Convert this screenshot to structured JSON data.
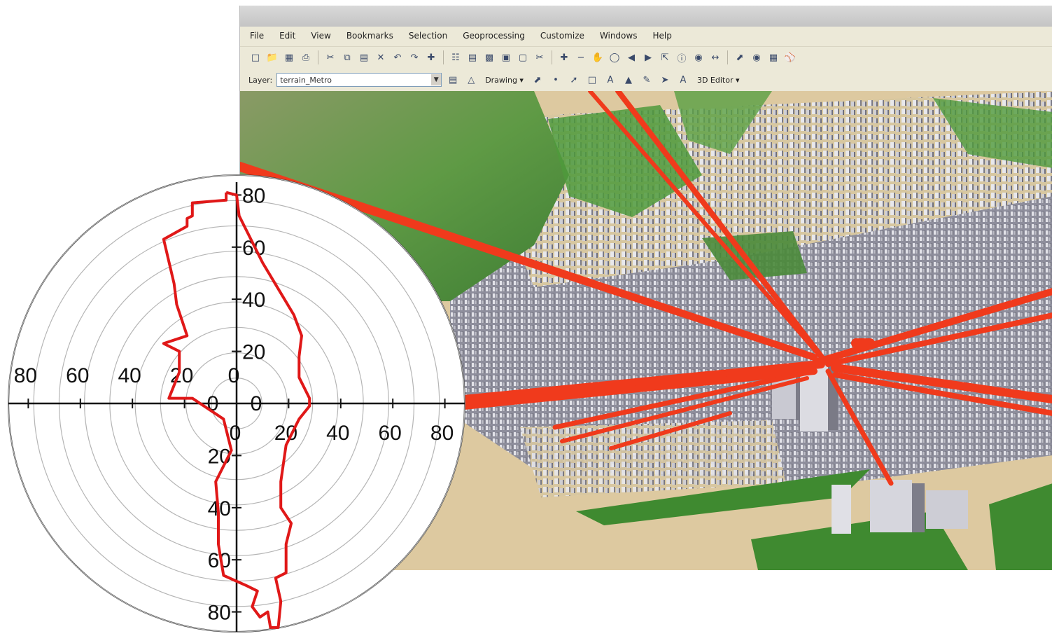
{
  "menu": {
    "items": [
      "File",
      "Edit",
      "View",
      "Bookmarks",
      "Selection",
      "Geoprocessing",
      "Customize",
      "Windows",
      "Help"
    ]
  },
  "toolbar1": {
    "icons": [
      "new-document-icon",
      "open-folder-icon",
      "save-icon",
      "print-icon",
      "cut-icon",
      "copy-icon",
      "paste-icon",
      "delete-icon",
      "undo-icon",
      "redo-icon",
      "add-data-icon",
      "zoom-in-icon",
      "zoom-out-icon",
      "pan-icon",
      "full-extent-icon",
      "identify-icon",
      "select-icon",
      "globe-icon",
      "binoculars-icon"
    ]
  },
  "toolbar2": {
    "layer_label": "Layer:",
    "layer_value": "terrain_Metro",
    "drawing_label": "Drawing ▾",
    "editor_label": "3D Editor ▾"
  },
  "colors": {
    "sightline": "#f03a1c",
    "polar_curve": "#e01818",
    "terrain_green": "#4a8a3a",
    "ground_sand": "#ddc9a0",
    "building_gray": "#9a9aa6"
  },
  "chart_data": {
    "type": "polar-line",
    "title": "",
    "radial_range": [
      0,
      80
    ],
    "grid": true,
    "tick_labels": {
      "top": [
        "20",
        "40",
        "60",
        "80"
      ],
      "right": [
        "20",
        "40",
        "60",
        "80"
      ],
      "left": [
        "20",
        "40",
        "60",
        "80"
      ],
      "bottom": [
        "20",
        "40",
        "60",
        "80"
      ],
      "center": [
        "0",
        "0",
        "0",
        "0"
      ]
    },
    "series": [
      {
        "values_xy": [
          [
            -4,
            81
          ],
          [
            -4,
            78
          ],
          [
            -17,
            77
          ],
          [
            -17,
            72
          ],
          [
            -19,
            71
          ],
          [
            -19,
            68
          ],
          [
            -28,
            63
          ],
          [
            -24,
            46
          ],
          [
            -23,
            38
          ],
          [
            -19,
            26
          ],
          [
            -28,
            23
          ],
          [
            -22,
            20
          ],
          [
            -22,
            12
          ],
          [
            -26,
            2
          ],
          [
            -17,
            2
          ],
          [
            -5,
            -6
          ],
          [
            -2,
            -18
          ],
          [
            -8,
            -30
          ],
          [
            -7,
            -42
          ],
          [
            -7,
            -54
          ],
          [
            -5,
            -66
          ],
          [
            4,
            -70
          ],
          [
            8,
            -72
          ],
          [
            6,
            -78
          ],
          [
            9,
            -82
          ],
          [
            12,
            -80
          ],
          [
            13,
            -86
          ],
          [
            16,
            -86
          ],
          [
            17,
            -76
          ],
          [
            15,
            -67
          ],
          [
            19,
            -65
          ],
          [
            19,
            -54
          ],
          [
            21,
            -46
          ],
          [
            17,
            -40
          ],
          [
            17,
            -30
          ],
          [
            19,
            -16
          ],
          [
            24,
            -6
          ],
          [
            28,
            -1
          ],
          [
            28,
            2
          ],
          [
            24,
            10
          ],
          [
            24,
            18
          ],
          [
            25,
            26
          ],
          [
            22,
            34
          ],
          [
            16,
            44
          ],
          [
            10,
            54
          ],
          [
            5,
            64
          ],
          [
            1,
            72
          ],
          [
            0,
            80
          ],
          [
            -4,
            81
          ]
        ]
      }
    ]
  }
}
